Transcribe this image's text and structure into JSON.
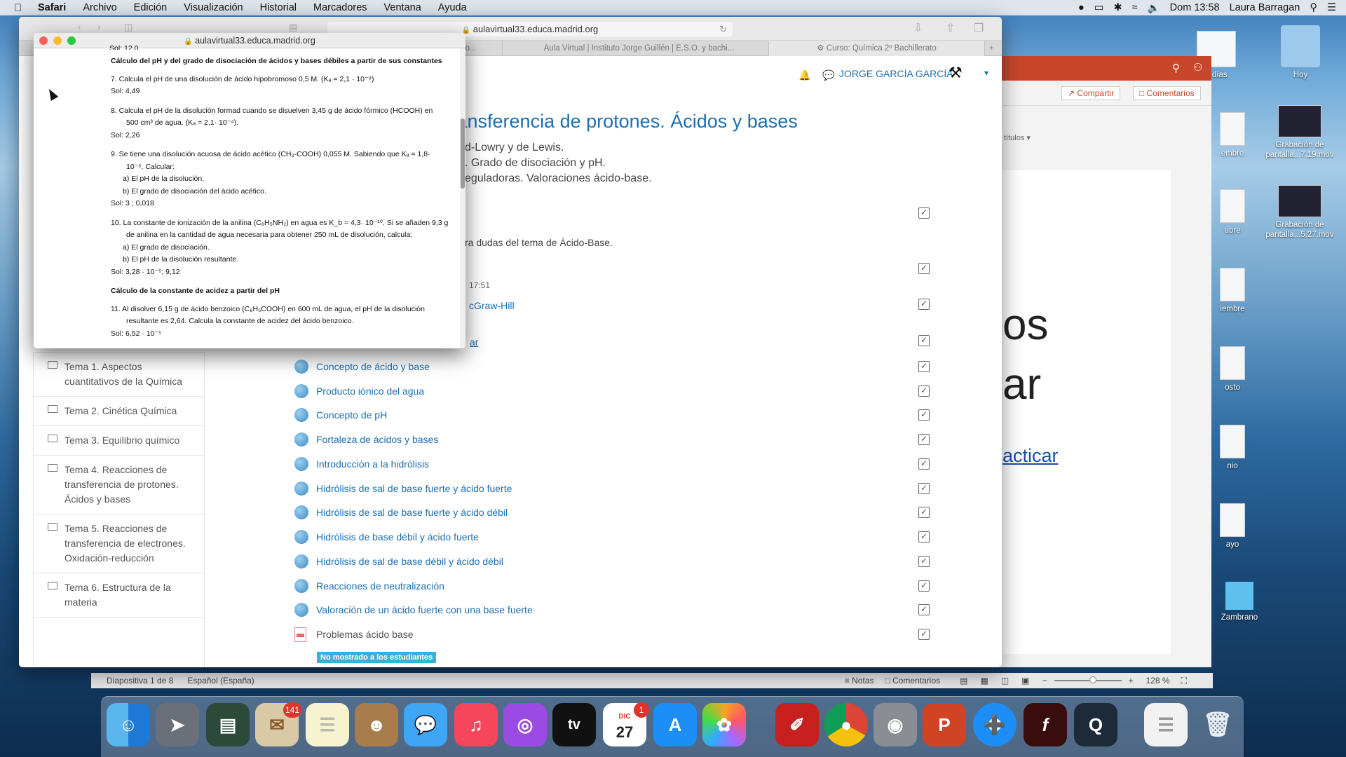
{
  "menubar": {
    "app": "Safari",
    "items": [
      "Archivo",
      "Edición",
      "Visualización",
      "Historial",
      "Marcadores",
      "Ventana",
      "Ayuda"
    ],
    "clock": "Dom 13:58",
    "user": "Laura Barragan"
  },
  "desktop": {
    "items": [
      {
        "label": "Hoy"
      },
      {
        "label": "7 días"
      },
      {
        "label": "Grabación de pantalla...7.19.mov"
      },
      {
        "label": "Grabación de pantalla...5.27.mov"
      },
      {
        "label": "embre"
      },
      {
        "label": "ubre"
      },
      {
        "label": "iembre"
      },
      {
        "label": "osto"
      },
      {
        "label": "nio"
      },
      {
        "label": "ayo"
      },
      {
        "label": "Zambrano"
      }
    ]
  },
  "safari": {
    "url": "aulavirtual33.educa.madrid.org",
    "tabs": [
      "bro...",
      "Aula Virtual | Instituto Jorge Guillén | E.S.O. y bachi...",
      "Curso: Química 2º Bachillerato"
    ],
    "user_name": "JORGE GARCÍA GARCÍA",
    "heading": "transferencia de protones. Ácidos y bases",
    "sublines": [
      "d-Lowry y de Lewis.",
      ". Grado de disociación y pH.",
      "eguladoras. Valoraciones ácido-base."
    ],
    "notes": [
      "ra dudas del tema de Ácido-Base.",
      "17:51",
      "cGraw-Hill",
      "ar"
    ],
    "activities": [
      "Concepto de ácido y base",
      "Producto iónico del agua",
      "Concepto de pH",
      "Fortaleza de ácidos y bases",
      "Introducción a la hidrólisis",
      "Hidrólisis de sal de base fuerte y ácido fuerte",
      "Hidrólisis de sal de base fuerte y ácido débil",
      "Hidrólisis de base débil y ácido fuerte",
      "Hidrólisis de sal de base débil y ácido débil",
      "Reacciones de neutralización",
      "Valoración de un ácido fuerte con una base fuerte",
      "Problemas ácido base"
    ],
    "hidden_badge": "No mostrado a los estudiantes",
    "sidebar": [
      "Tema 1. Aspectos cuantitativos de la Química",
      "Tema 2. Cinética Química",
      "Tema 3. Equilibrio químico",
      "Tema 4. Reacciones de transferencia de protones. Ácidos y bases",
      "Tema 5. Reacciones de transferencia de electrones. Oxidación-reducción",
      "Tema 6. Estructura de la materia"
    ]
  },
  "ppt": {
    "share": "Compartir",
    "comments": "Comentarios",
    "subtitles": "títulos",
    "big1": "os",
    "big2": "ar",
    "link": "acticar",
    "status_slide": "Diapositiva 1 de 8",
    "status_lang": "Español (España)",
    "notes": "Notas",
    "comments2": "Comentarios",
    "zoom": "128 %"
  },
  "popup": {
    "url": "aulavirtual33.educa.madrid.org",
    "top_cut": "Sol: 12,0",
    "section1": "Cálculo del pH  y del grado de disociación de ácidos y bases débiles a partir de sus constantes",
    "q7": "7.   Calcula el pH de una disolución de ácido hipobromoso 0,5 M. (Kₐ = 2,1 · 10⁻⁹)",
    "s7": "Sol: 4,49",
    "q8a": "8.   Calcula el pH de la disolución formad cuando se disuelven 3,45 g de ácido fórmico (HCOOH) en",
    "q8b": "500 cm³ de agua. (Kₐ = 2,1· 10⁻⁴).",
    "s8": "Sol: 2,26",
    "q9a": "9.   Se tiene una disolución acuosa de ácido acético (CH₃-COOH) 0,055 M. Sabiendo que Kₐ = 1,8·",
    "q9b": "10⁻⁵. Calcular:",
    "q9c": "a)   El pH de la disolución.",
    "q9d": "b)   El grado de disociación del ácido acético.",
    "s9": "Sol: 3 ; 0,018",
    "q10a": "10.  La constante de ionización de la anilina (C₆H₅NH₂) en agua es K_b = 4,3· 10⁻¹⁰. Si se añaden 9,3 g",
    "q10b": "de anilina en la cantidad de agua necesaria para obtener 250 mL de disolución, calcula:",
    "q10c": "a)   El grado de disociación.",
    "q10d": "b)   El pH de la disolución resultante.",
    "s10": "Sol: 3,28 · 10⁻⁵; 9,12",
    "section2": "Cálculo de la constante de acidez a partir del pH",
    "q11a": "11.  Al disolver 6,15 g de ácido benzoico (C₆H₅COOH) en 600 mL de agua, el pH de la disolución",
    "q11b": "resultante es 2,64. Calcula la constante de acidez del ácido benzoico.",
    "s11": "Sol: 6,52 · 10⁻⁵"
  },
  "dock": {
    "mail_badge": "141",
    "cal_month": "DIC",
    "cal_day": "27",
    "cal_badge": "1",
    "tv": "tv"
  }
}
